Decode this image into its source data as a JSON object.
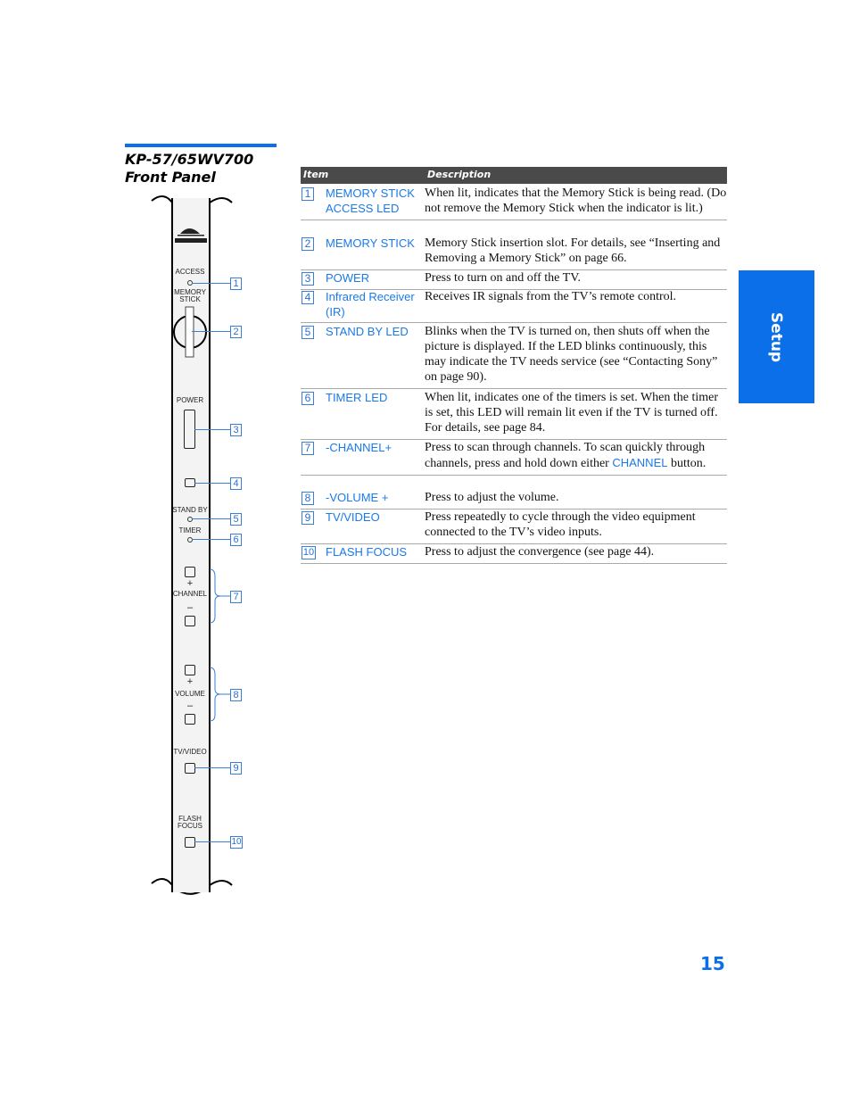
{
  "header": {
    "model": "KP-57/65WV700",
    "section": "Front Panel"
  },
  "panel": {
    "labels": {
      "access": "ACCESS",
      "memory_stick": "MEMORY STICK",
      "power": "POWER",
      "stand_by": "STAND BY",
      "timer": "TIMER",
      "plus": "+",
      "channel": "CHANNEL",
      "minus": "–",
      "volume": "VOLUME",
      "tv_video": "TV/VIDEO",
      "flash_focus": "FLASH FOCUS"
    },
    "callouts": [
      "1",
      "2",
      "3",
      "4",
      "5",
      "6",
      "7",
      "8",
      "9",
      "10"
    ]
  },
  "table": {
    "headers": {
      "item": "Item",
      "description": "Description"
    },
    "rows": [
      {
        "num": "1",
        "item": "MEMORY STICK ACCESS LED",
        "desc": "When lit, indicates that the Memory Stick is being read. (Do not remove the Memory Stick when the indicator is lit.)"
      },
      {
        "num": "2",
        "item": "MEMORY STICK",
        "desc": "Memory Stick insertion slot. For details, see “Inserting and Removing a Memory Stick” on page 66."
      },
      {
        "num": "3",
        "item": "POWER",
        "desc": "Press to turn on and off the TV."
      },
      {
        "num": "4",
        "item": "Infrared Receiver (IR)",
        "desc": "Receives IR signals from the TV’s remote control."
      },
      {
        "num": "5",
        "item": "STAND BY LED",
        "desc": "Blinks when the TV is turned on, then shuts off when the picture is displayed. If the LED blinks continuously, this may indicate the TV needs service (see “Contacting Sony” on page 90)."
      },
      {
        "num": "6",
        "item": "TIMER LED",
        "desc": "When lit, indicates one of the timers is set. When the timer is set, this LED will remain lit even if the TV is turned off. For details, see page 84."
      },
      {
        "num": "7",
        "item": "-CHANNEL+",
        "desc": "Press to scan through channels. To scan quickly through channels, press and hold down either",
        "desc_link": "CHANNEL",
        "desc_end": " button."
      },
      {
        "num": "8",
        "item": "-VOLUME +",
        "desc": "Press to adjust the volume."
      },
      {
        "num": "9",
        "item": "TV/VIDEO",
        "desc": "Press repeatedly to cycle through the video equipment connected to the TV’s video inputs."
      },
      {
        "num": "10",
        "item": "FLASH FOCUS",
        "desc": "Press to adjust the convergence (see page 44)."
      }
    ]
  },
  "side_tab": {
    "label": "Setup",
    "color": "#0a6fe8"
  },
  "page_number": "15"
}
